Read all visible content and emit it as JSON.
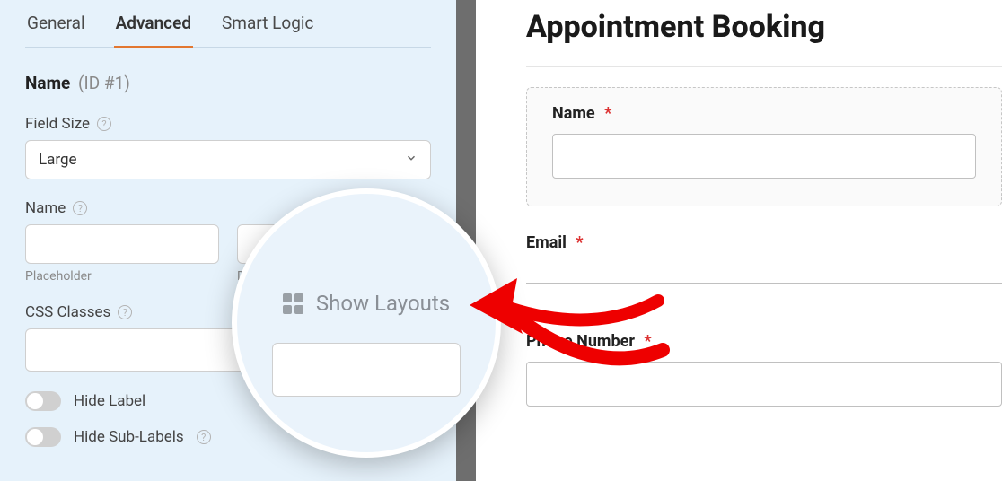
{
  "tabs": {
    "general": "General",
    "advanced": "Advanced",
    "smart": "Smart Logic"
  },
  "section": {
    "title": "Name",
    "id": "(ID #1)"
  },
  "field_size": {
    "label": "Field Size",
    "value": "Large"
  },
  "name_field": {
    "label": "Name",
    "placeholder_sub": "Placeholder",
    "default_sub": "De"
  },
  "css_classes": {
    "label": "CSS Classes"
  },
  "toggles": {
    "hide_label": "Hide Label",
    "hide_sublabels": "Hide Sub-Labels"
  },
  "magnifier": {
    "label": "Show Layouts"
  },
  "preview": {
    "title": "Appointment Booking",
    "name_label": "Name",
    "email_label": "Email",
    "phone_label": "Phone Number",
    "required": "*"
  }
}
